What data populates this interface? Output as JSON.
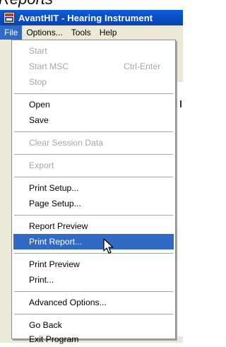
{
  "background": {
    "partial_text": "Reports"
  },
  "window": {
    "title": "AvantHIT - Hearing Instrument",
    "icon": "avanthit-app-icon"
  },
  "menubar": {
    "items": [
      {
        "label": "File",
        "active": true
      },
      {
        "label": "Options..."
      },
      {
        "label": "Tools"
      },
      {
        "label": "Help"
      }
    ]
  },
  "file_menu": {
    "items": [
      {
        "label": "Start",
        "enabled": false
      },
      {
        "label": "Start MSC",
        "shortcut": "Ctrl-Enter",
        "enabled": false
      },
      {
        "label": "Stop",
        "enabled": false
      },
      {
        "label": "Open",
        "enabled": true
      },
      {
        "label": "Save",
        "enabled": true
      },
      {
        "label": "Clear Session Data",
        "enabled": false
      },
      {
        "label": "Export",
        "enabled": false
      },
      {
        "label": "Print Setup...",
        "enabled": true
      },
      {
        "label": "Page Setup...",
        "enabled": true
      },
      {
        "label": "Report Preview",
        "enabled": true
      },
      {
        "label": "Print Report...",
        "enabled": true,
        "highlighted": true
      },
      {
        "label": "Print Preview",
        "enabled": true
      },
      {
        "label": "Print...",
        "enabled": true
      },
      {
        "label": "Advanced Options...",
        "enabled": true
      },
      {
        "label": "Go Back",
        "enabled": true
      },
      {
        "label": "Exit Program",
        "enabled": true
      }
    ]
  },
  "colors": {
    "titlebar": "#0b4fc8",
    "highlight": "#316ac5",
    "menubar": "#ece9d8",
    "disabled_text": "#a7a6aa"
  },
  "pointer": "arrow-cursor-icon"
}
